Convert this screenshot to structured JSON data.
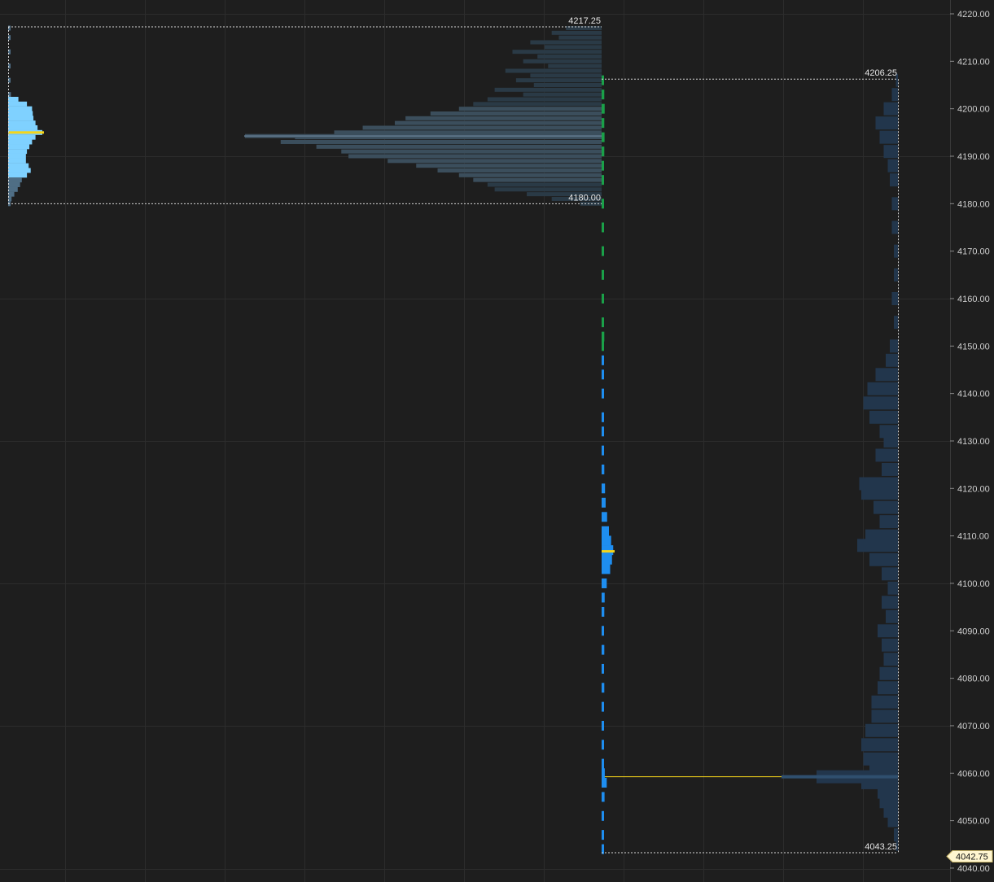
{
  "chart_data": {
    "type": "volume-profile",
    "y_axis": {
      "min": 4040,
      "max": 4220,
      "ticks": [
        "4040.00",
        "4050.00",
        "4060.00",
        "4070.00",
        "4080.00",
        "4090.00",
        "4100.00",
        "4110.00",
        "4120.00",
        "4130.00",
        "4140.00",
        "4150.00",
        "4160.00",
        "4170.00",
        "4180.00",
        "4190.00",
        "4200.00",
        "4210.00",
        "4220.00"
      ]
    },
    "grid": true,
    "colors": {
      "background": "#1e1e1e",
      "grid": "#2c2c2c",
      "profile_fill": "#2a3a46",
      "profile_value_area": "#3b4e5c",
      "right_profile": "#22364c",
      "tpo_green": "#1aa048",
      "tpo_blue": "#1e8ef0",
      "tpo_light": "#7fd1ff",
      "poc": "#f5d51a",
      "last_price_bg": "#fff6d0"
    },
    "price_labels": [
      "4217.25",
      "4180.00",
      "4206.25",
      "4043.25"
    ],
    "last_price": "4042.75",
    "profiles": [
      {
        "name": "prior-session-profile",
        "high": 4217.25,
        "low": 4180.0,
        "poc": 4194.25,
        "value_area": [
          4185.0,
          4200.0
        ],
        "volumes": [
          [
            4217,
            0.1
          ],
          [
            4216,
            0.14
          ],
          [
            4215,
            0.12
          ],
          [
            4214,
            0.2
          ],
          [
            4213,
            0.16
          ],
          [
            4212,
            0.25
          ],
          [
            4211,
            0.18
          ],
          [
            4210,
            0.22
          ],
          [
            4209,
            0.15
          ],
          [
            4208,
            0.27
          ],
          [
            4207,
            0.2
          ],
          [
            4206,
            0.24
          ],
          [
            4205,
            0.19
          ],
          [
            4204,
            0.3
          ],
          [
            4203,
            0.22
          ],
          [
            4202,
            0.32
          ],
          [
            4201,
            0.36
          ],
          [
            4200,
            0.4
          ],
          [
            4199,
            0.48
          ],
          [
            4198,
            0.55
          ],
          [
            4197,
            0.58
          ],
          [
            4196,
            0.67
          ],
          [
            4195,
            0.75
          ],
          [
            4194.25,
            1.0
          ],
          [
            4194,
            0.86
          ],
          [
            4193,
            0.9
          ],
          [
            4192,
            0.8
          ],
          [
            4191,
            0.73
          ],
          [
            4190,
            0.71
          ],
          [
            4189,
            0.6
          ],
          [
            4188,
            0.52
          ],
          [
            4187,
            0.46
          ],
          [
            4186,
            0.4
          ],
          [
            4185,
            0.36
          ],
          [
            4184,
            0.32
          ],
          [
            4183,
            0.3
          ],
          [
            4182,
            0.21
          ],
          [
            4181,
            0.14
          ],
          [
            4180,
            0.06
          ]
        ]
      },
      {
        "name": "current-session-profile",
        "high": 4206.25,
        "low": 4043.25,
        "poc": 4059.25,
        "volumes": [
          [
            4206,
            0.01
          ],
          [
            4203,
            0.03
          ],
          [
            4200,
            0.07
          ],
          [
            4197,
            0.11
          ],
          [
            4194,
            0.09
          ],
          [
            4191,
            0.07
          ],
          [
            4188,
            0.05
          ],
          [
            4185,
            0.04
          ],
          [
            4180,
            0.03
          ],
          [
            4175,
            0.03
          ],
          [
            4170,
            0.02
          ],
          [
            4165,
            0.02
          ],
          [
            4160,
            0.03
          ],
          [
            4155,
            0.02
          ],
          [
            4150,
            0.04
          ],
          [
            4147,
            0.06
          ],
          [
            4144,
            0.11
          ],
          [
            4141,
            0.15
          ],
          [
            4138,
            0.17
          ],
          [
            4135,
            0.14
          ],
          [
            4132,
            0.09
          ],
          [
            4130,
            0.07
          ],
          [
            4127,
            0.11
          ],
          [
            4124,
            0.08
          ],
          [
            4121,
            0.19
          ],
          [
            4119,
            0.18
          ],
          [
            4116,
            0.12
          ],
          [
            4113,
            0.09
          ],
          [
            4110,
            0.16
          ],
          [
            4108,
            0.2
          ],
          [
            4105,
            0.14
          ],
          [
            4102,
            0.08
          ],
          [
            4099,
            0.05
          ],
          [
            4096,
            0.08
          ],
          [
            4093,
            0.06
          ],
          [
            4090,
            0.1
          ],
          [
            4087,
            0.08
          ],
          [
            4084,
            0.07
          ],
          [
            4081,
            0.09
          ],
          [
            4078,
            0.1
          ],
          [
            4075,
            0.13
          ],
          [
            4072,
            0.13
          ],
          [
            4069,
            0.16
          ],
          [
            4066,
            0.18
          ],
          [
            4063,
            0.17
          ],
          [
            4061,
            0.14
          ],
          [
            4059.25,
            0.4
          ],
          [
            4058,
            0.18
          ],
          [
            4056,
            0.1
          ],
          [
            4054,
            0.09
          ],
          [
            4052,
            0.07
          ],
          [
            4050,
            0.05
          ],
          [
            4047,
            0.02
          ],
          [
            4045,
            0.01
          ]
        ]
      }
    ],
    "tpo_columns": [
      {
        "name": "prior-session-tpo",
        "high": 4217.25,
        "low": 4180.0,
        "poc": 4195.0,
        "widths": [
          [
            4217,
            0.05
          ],
          [
            4215,
            0.04
          ],
          [
            4212,
            0.05
          ],
          [
            4209,
            0.05
          ],
          [
            4206,
            0.06
          ],
          [
            4203,
            0.08
          ],
          [
            4202,
            0.3
          ],
          [
            4201,
            0.55
          ],
          [
            4200,
            0.7
          ],
          [
            4199,
            0.72
          ],
          [
            4198,
            0.74
          ],
          [
            4197,
            0.8
          ],
          [
            4196,
            0.86
          ],
          [
            4195,
            1.0
          ],
          [
            4194,
            0.8
          ],
          [
            4193,
            0.7
          ],
          [
            4192,
            0.62
          ],
          [
            4191,
            0.55
          ],
          [
            4190,
            0.52
          ],
          [
            4189,
            0.52
          ],
          [
            4188,
            0.6
          ],
          [
            4187,
            0.66
          ],
          [
            4186,
            0.55
          ],
          [
            4185,
            0.4
          ],
          [
            4184,
            0.35
          ],
          [
            4183,
            0.28
          ],
          [
            4182,
            0.18
          ],
          [
            4181,
            0.1
          ],
          [
            4180,
            0.05
          ]
        ]
      },
      {
        "name": "current-session-tpo",
        "high": 4206.25,
        "low": 4043.25,
        "poc": 4106.75,
        "widths": [
          [
            4206,
            0.15
          ],
          [
            4203,
            0.22
          ],
          [
            4200,
            0.25
          ],
          [
            4197,
            0.22
          ],
          [
            4194,
            0.24
          ],
          [
            4191,
            0.22
          ],
          [
            4188,
            0.18
          ],
          [
            4185,
            0.1
          ],
          [
            4180,
            0.1
          ],
          [
            4175,
            0.1
          ],
          [
            4170,
            0.1
          ],
          [
            4165,
            0.1
          ],
          [
            4160,
            0.1
          ],
          [
            4155,
            0.15
          ],
          [
            4152,
            0.22
          ],
          [
            4150,
            0.18
          ],
          [
            4147,
            0.1
          ],
          [
            4144,
            0.1
          ],
          [
            4140,
            0.1
          ],
          [
            4135,
            0.12
          ],
          [
            4132,
            0.18
          ],
          [
            4128,
            0.2
          ],
          [
            4124,
            0.22
          ],
          [
            4120,
            0.28
          ],
          [
            4117,
            0.33
          ],
          [
            4114,
            0.45
          ],
          [
            4111,
            0.6
          ],
          [
            4109,
            0.78
          ],
          [
            4107,
            0.95
          ],
          [
            4105,
            0.85
          ],
          [
            4103,
            0.7
          ],
          [
            4100,
            0.42
          ],
          [
            4097,
            0.25
          ],
          [
            4094,
            0.22
          ],
          [
            4090,
            0.2
          ],
          [
            4086,
            0.22
          ],
          [
            4082,
            0.2
          ],
          [
            4078,
            0.22
          ],
          [
            4074,
            0.18
          ],
          [
            4070,
            0.16
          ],
          [
            4066,
            0.16
          ],
          [
            4062,
            0.16
          ],
          [
            4060,
            0.26
          ],
          [
            4058,
            0.42
          ],
          [
            4055,
            0.24
          ],
          [
            4051,
            0.18
          ],
          [
            4047,
            0.15
          ],
          [
            4044,
            0.12
          ]
        ]
      }
    ]
  }
}
